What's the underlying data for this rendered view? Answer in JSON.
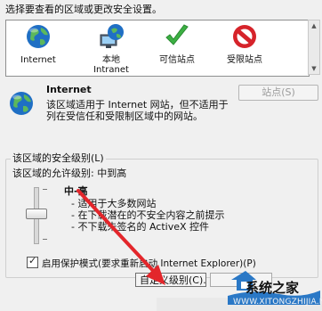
{
  "intro_text": "选择要查看的区域或更改安全设置。",
  "zones": [
    {
      "label": "Internet",
      "icon": "globe-icon"
    },
    {
      "label": "本地\nIntranet",
      "icon": "intranet-icon"
    },
    {
      "label": "可信站点",
      "icon": "checkmark-icon"
    },
    {
      "label": "受限站点",
      "icon": "restricted-icon"
    }
  ],
  "zone_detail": {
    "title": "Internet",
    "description": "该区域适用于 Internet 网站，但不适用于列在受信任和受限制区域中的网站。",
    "sites_button": "站点(S)"
  },
  "security_level": {
    "group_title": "该区域的安全级别(L)",
    "allowed_levels": "该区域的允许级别: 中到高",
    "level_name": "中-高",
    "level_points": [
      "- 适用于大多数网站",
      "- 在下载潜在的不安全内容之前提示",
      "- 不下载未签名的 ActiveX 控件"
    ],
    "protected_mode_label": "启用保护模式(要求重新启动 Internet Explorer)(P)",
    "protected_mode_checked": true,
    "custom_level_button": "自定义级别(C)..."
  },
  "watermark": {
    "brand_text": "系统之家",
    "url_text": "WWW.XITONGZHIJIA.NET"
  },
  "colors": {
    "annotation_arrow": "#e3262b",
    "globe_blue": "#1f6fc4",
    "check_green": "#3cb043",
    "restricted_red": "#d6232a"
  }
}
